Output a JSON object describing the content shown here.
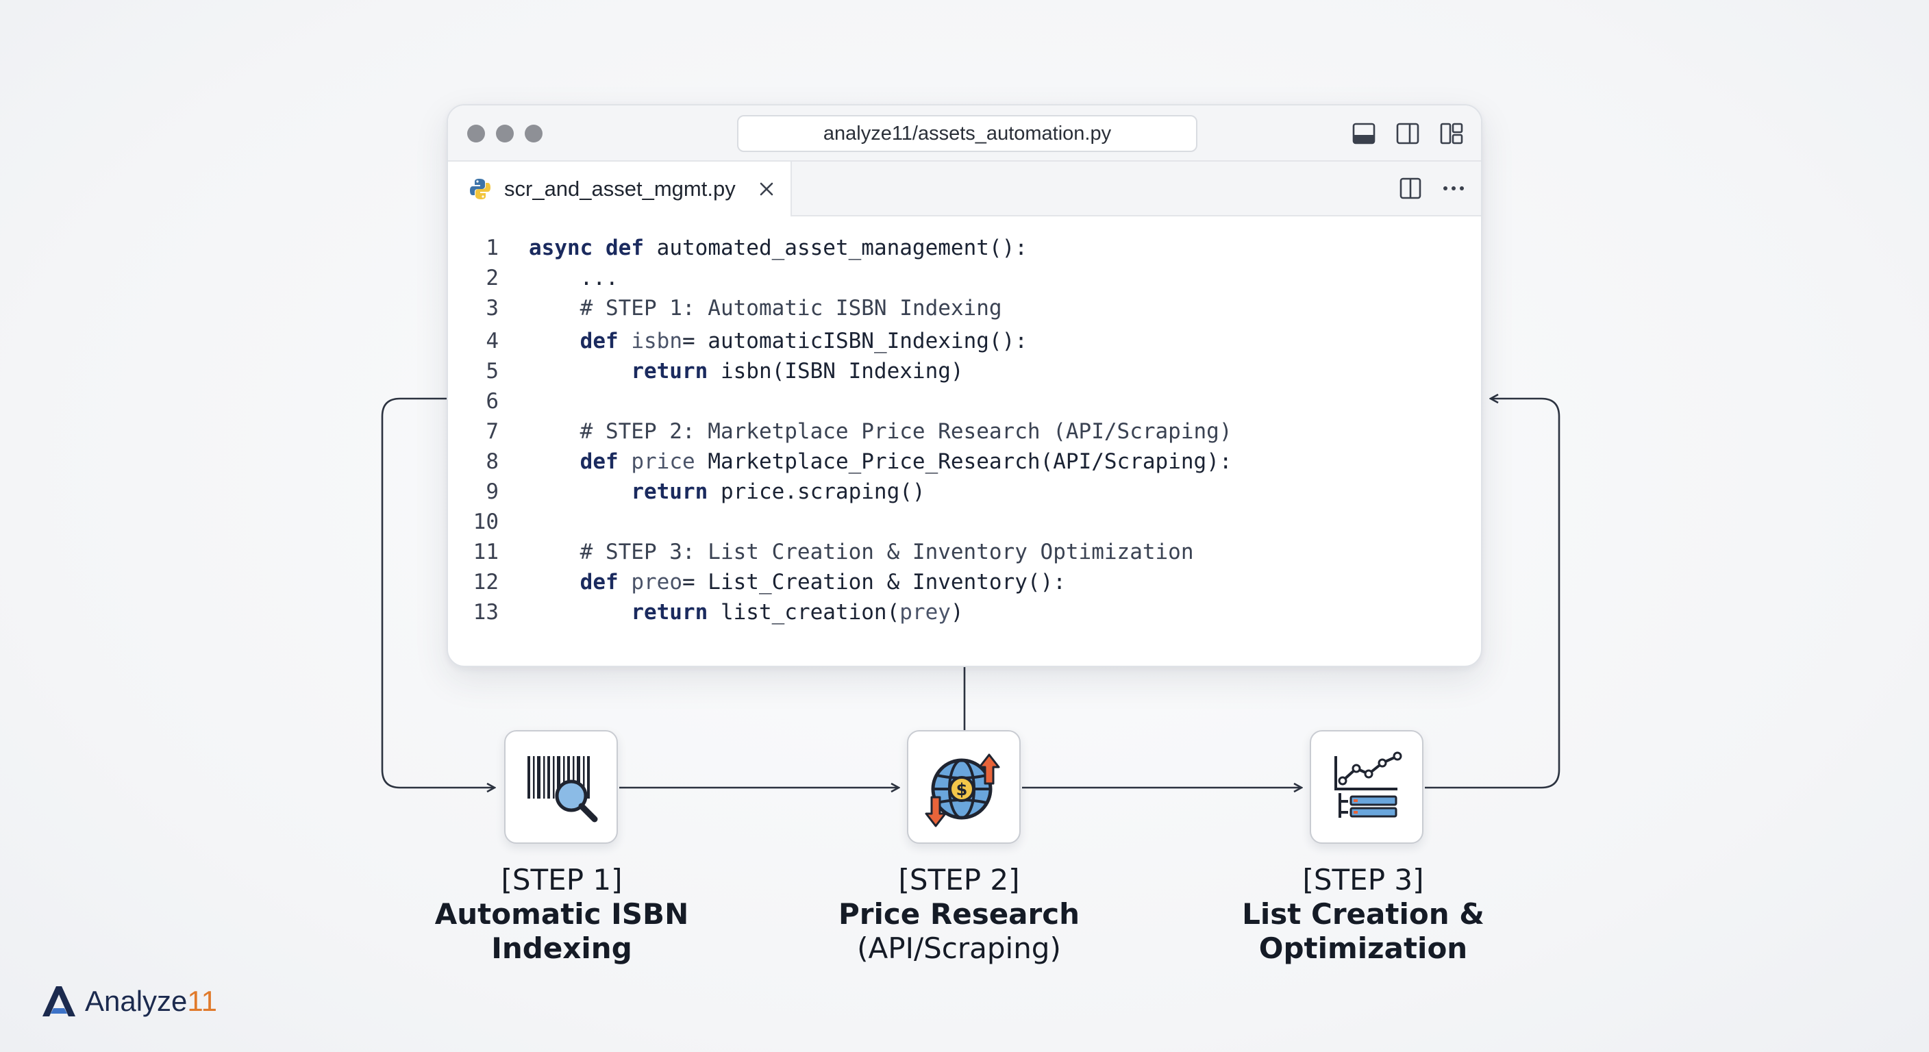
{
  "window": {
    "url": "analyze11/assets_automation.py",
    "tab_label": "scr_and_asset_mgmt.py",
    "icons": [
      "back-arrow-icon",
      "layout-bottom-panel-icon",
      "layout-side-panel-icon",
      "layout-grid-icon",
      "python-icon",
      "close-icon",
      "split-editor-icon",
      "more-icon"
    ]
  },
  "code_lines": [
    {
      "n": "1",
      "parts": [
        {
          "t": "async",
          "c": "kw"
        },
        {
          "t": " ",
          "c": ""
        },
        {
          "t": "def",
          "c": "kw"
        },
        {
          "t": " automated_asset_management():",
          "c": ""
        }
      ]
    },
    {
      "n": "2",
      "parts": [
        {
          "t": "    ...",
          "c": ""
        }
      ]
    },
    {
      "n": "3",
      "parts": [
        {
          "t": "    # STEP 1: Automatic ISBN Indexing",
          "c": "cm"
        }
      ]
    },
    {
      "n": "4",
      "parts": [
        {
          "t": "    ",
          "c": ""
        },
        {
          "t": "def",
          "c": "kw"
        },
        {
          "t": " ",
          "c": ""
        },
        {
          "t": "isbn",
          "c": "vr"
        },
        {
          "t": "= automaticISBN_Indexing():",
          "c": ""
        }
      ]
    },
    {
      "n": "5",
      "parts": [
        {
          "t": "        ",
          "c": ""
        },
        {
          "t": "return",
          "c": "kw"
        },
        {
          "t": " isbn(ISBN Indexing)",
          "c": ""
        }
      ]
    },
    {
      "n": "6",
      "parts": []
    },
    {
      "n": "7",
      "parts": [
        {
          "t": "    # STEP 2: Marketplace Price Research (API/Scraping)",
          "c": "cm"
        }
      ]
    },
    {
      "n": "8",
      "parts": [
        {
          "t": "    ",
          "c": ""
        },
        {
          "t": "def",
          "c": "kw"
        },
        {
          "t": " ",
          "c": ""
        },
        {
          "t": "price",
          "c": "vr"
        },
        {
          "t": " Marketplace_Price_Research(API/Scraping):",
          "c": ""
        }
      ]
    },
    {
      "n": "9",
      "parts": [
        {
          "t": "        ",
          "c": ""
        },
        {
          "t": "return",
          "c": "kw"
        },
        {
          "t": " price.scraping()",
          "c": ""
        }
      ]
    },
    {
      "n": "10",
      "parts": []
    },
    {
      "n": "11",
      "parts": [
        {
          "t": "    # STEP 3: List Creation & Inventory Optimization",
          "c": "cm"
        }
      ]
    },
    {
      "n": "12",
      "parts": [
        {
          "t": "    ",
          "c": ""
        },
        {
          "t": "def",
          "c": "kw"
        },
        {
          "t": " ",
          "c": ""
        },
        {
          "t": "preo",
          "c": "vr"
        },
        {
          "t": "= List_Creation & Inventory():",
          "c": ""
        }
      ]
    },
    {
      "n": "13",
      "parts": [
        {
          "t": "        ",
          "c": ""
        },
        {
          "t": "return",
          "c": "kw"
        },
        {
          "t": " list_creation(",
          "c": ""
        },
        {
          "t": "prey",
          "c": "vr"
        },
        {
          "t": ")",
          "c": ""
        }
      ]
    }
  ],
  "steps": [
    {
      "number": "[STEP 1]",
      "line1": "Automatic ISBN",
      "line2": "Indexing",
      "icon": "barcode-search-icon"
    },
    {
      "number": "[STEP 2]",
      "line1": "Price Research",
      "line2": "(API/Scraping)",
      "icon": "globe-price-icon"
    },
    {
      "number": "[STEP 3]",
      "line1": "List Creation &",
      "line2": "Optimization",
      "icon": "chart-list-icon"
    }
  ],
  "logo": {
    "name": "Analyze",
    "accent": "11",
    "icon": "analyze11-logo-icon"
  },
  "colors": {
    "accent": "#e07a2c",
    "brand": "#1b2a4e",
    "arrow": "#2c3340",
    "icon_blue": "#5b9bd5",
    "icon_orange": "#e8643a"
  }
}
